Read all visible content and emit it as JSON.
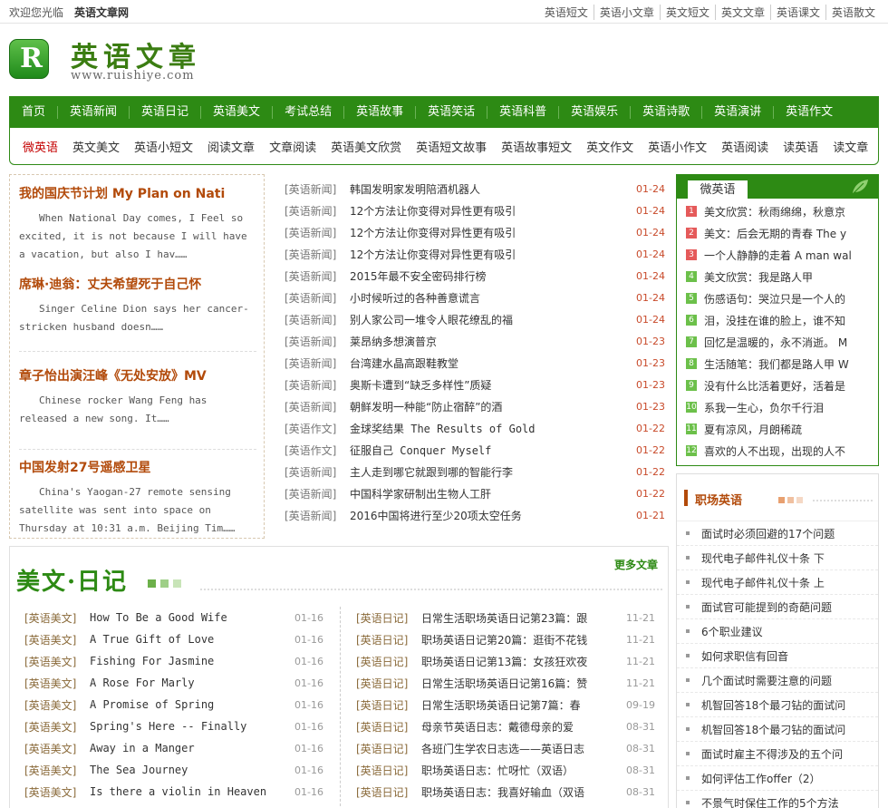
{
  "topbar": {
    "welcome": "欢迎您光临",
    "sitename": "英语文章网",
    "links": [
      "英语短文",
      "英语小文章",
      "英文短文",
      "英文文章",
      "英语课文",
      "英语散文"
    ]
  },
  "logo": {
    "letter": "R",
    "title": "英语文章",
    "url": "www.ruishiye.com"
  },
  "nav": {
    "main": [
      "首页",
      "英语新闻",
      "英语日记",
      "英语美文",
      "考试总结",
      "英语故事",
      "英语笑话",
      "英语科普",
      "英语娱乐",
      "英语诗歌",
      "英语演讲",
      "英语作文"
    ],
    "sub": [
      "微英语",
      "英文美文",
      "英语小短文",
      "阅读文章",
      "文章阅读",
      "英语美文欣赏",
      "英语短文故事",
      "英语故事短文",
      "英文作文",
      "英语小作文",
      "英语阅读",
      "读英语",
      "读文章"
    ]
  },
  "featured": [
    {
      "title": "我的国庆节计划 My Plan on Nati",
      "summary": "When National Day comes, I Feel so excited, it is not because I will have a vacation, but also I hav……"
    },
    {
      "title": "席琳·迪翁：丈夫希望死于自己怀",
      "summary": "Singer Celine Dion says her cancer-stricken husband doesn……"
    },
    {
      "title": "章子怡出演汪峰《无处安放》MV",
      "summary": "Chinese rocker Wang Feng has released a new song. It……"
    },
    {
      "title": "中国发射27号遥感卫星",
      "summary": "China's Yaogan-27 remote sensing satellite was sent into space on Thursday at 10:31 a.m. Beijing Tim……"
    }
  ],
  "news": [
    {
      "cat": "[英语新闻]",
      "title": "韩国发明家发明陪酒机器人",
      "date": "01-24"
    },
    {
      "cat": "[英语新闻]",
      "title": "12个方法让你变得对异性更有吸引",
      "date": "01-24"
    },
    {
      "cat": "[英语新闻]",
      "title": "12个方法让你变得对异性更有吸引",
      "date": "01-24"
    },
    {
      "cat": "[英语新闻]",
      "title": "12个方法让你变得对异性更有吸引",
      "date": "01-24"
    },
    {
      "cat": "[英语新闻]",
      "title": "2015年最不安全密码排行榜",
      "date": "01-24"
    },
    {
      "cat": "[英语新闻]",
      "title": "小时候听过的各种善意谎言",
      "date": "01-24"
    },
    {
      "cat": "[英语新闻]",
      "title": "别人家公司一堆令人眼花缭乱的福",
      "date": "01-24"
    },
    {
      "cat": "[英语新闻]",
      "title": "莱昂纳多想演普京",
      "date": "01-23"
    },
    {
      "cat": "[英语新闻]",
      "title": "台湾建水晶高跟鞋教堂",
      "date": "01-23"
    },
    {
      "cat": "[英语新闻]",
      "title": "奥斯卡遭到“缺乏多样性”质疑",
      "date": "01-23"
    },
    {
      "cat": "[英语新闻]",
      "title": "朝鲜发明一种能“防止宿醉”的酒",
      "date": "01-23"
    },
    {
      "cat": "[英语作文]",
      "title": "金球奖结果 The Results of Gold",
      "date": "01-22"
    },
    {
      "cat": "[英语作文]",
      "title": "征服自己 Conquer Myself",
      "date": "01-22"
    },
    {
      "cat": "[英语新闻]",
      "title": "主人走到哪它就跟到哪的智能行李",
      "date": "01-22"
    },
    {
      "cat": "[英语新闻]",
      "title": "中国科学家研制出生物人工肝",
      "date": "01-22"
    },
    {
      "cat": "[英语新闻]",
      "title": "2016中国将进行至少20项太空任务",
      "date": "01-21"
    }
  ],
  "micro": {
    "tab": "微英语",
    "items": [
      {
        "n": "1",
        "title": "美文欣赏：秋雨绵绵，秋意京"
      },
      {
        "n": "2",
        "title": "美文：后会无期的青春 The y"
      },
      {
        "n": "3",
        "title": "一个人静静的走着 A man wal"
      },
      {
        "n": "4",
        "title": "美文欣赏：我是路人甲"
      },
      {
        "n": "5",
        "title": "伤感语句：哭泣只是一个人的"
      },
      {
        "n": "6",
        "title": "泪，没挂在谁的脸上，谁不知"
      },
      {
        "n": "7",
        "title": "回忆是温暖的，永不消逝。 M"
      },
      {
        "n": "8",
        "title": "生活随笔：我们都是路人甲 W"
      },
      {
        "n": "9",
        "title": "没有什么比活着更好，活着是"
      },
      {
        "n": "10",
        "title": "系我一生心，负尔千行泪"
      },
      {
        "n": "11",
        "title": "夏有凉风，月朗稀疏"
      },
      {
        "n": "12",
        "title": "喜欢的人不出现，出现的人不"
      }
    ]
  },
  "career": {
    "title": "职场英语",
    "items": [
      "面试时必须回避的17个问题",
      "现代电子邮件礼仪十条 下",
      "现代电子邮件礼仪十条 上",
      "面试官可能提到的奇葩问题",
      "6个职业建议",
      "如何求职信有回音",
      "几个面试时需要注意的问题",
      "机智回答18个最刁钻的面试问",
      "机智回答18个最刁钻的面试问",
      "面试时雇主不得涉及的五个问",
      "如何评估工作offer（2）",
      "不景气时保住工作的5个方法"
    ]
  },
  "articles": {
    "title": "美文·日记",
    "more": "更多文章",
    "left": [
      {
        "cat": "[英语美文]",
        "title": "How To Be a Good Wife",
        "date": "01-16"
      },
      {
        "cat": "[英语美文]",
        "title": "A True Gift of Love",
        "date": "01-16"
      },
      {
        "cat": "[英语美文]",
        "title": "Fishing For Jasmine",
        "date": "01-16"
      },
      {
        "cat": "[英语美文]",
        "title": "A Rose For Marly",
        "date": "01-16"
      },
      {
        "cat": "[英语美文]",
        "title": "A Promise of Spring",
        "date": "01-16"
      },
      {
        "cat": "[英语美文]",
        "title": "Spring's Here -- Finally",
        "date": "01-16"
      },
      {
        "cat": "[英语美文]",
        "title": "Away in a Manger",
        "date": "01-16"
      },
      {
        "cat": "[英语美文]",
        "title": "The Sea Journey",
        "date": "01-16"
      },
      {
        "cat": "[英语美文]",
        "title": "Is there a violin in Heaven",
        "date": "01-16"
      }
    ],
    "right": [
      {
        "cat": "[英语日记]",
        "title": "日常生活职场英语日记第23篇：跟",
        "date": "11-21"
      },
      {
        "cat": "[英语日记]",
        "title": "职场英语日记第20篇：逛街不花钱",
        "date": "11-21"
      },
      {
        "cat": "[英语日记]",
        "title": "职场英语日记第13篇：女孩狂欢夜",
        "date": "11-21"
      },
      {
        "cat": "[英语日记]",
        "title": "日常生活职场英语日记第16篇：赞",
        "date": "11-21"
      },
      {
        "cat": "[英语日记]",
        "title": "日常生活职场英语日记第7篇：春",
        "date": "09-19"
      },
      {
        "cat": "[英语日记]",
        "title": "母亲节英语日志：戴德母亲的爱",
        "date": "08-31"
      },
      {
        "cat": "[英语日记]",
        "title": "各班门生学农日志选——英语日志",
        "date": "08-31"
      },
      {
        "cat": "[英语日记]",
        "title": "职场英语日志：忙呀忙（双语）",
        "date": "08-31"
      },
      {
        "cat": "[英语日记]",
        "title": "职场英语日志：我喜好输血（双语",
        "date": "08-31"
      }
    ]
  },
  "colors": {
    "brand_green": "#2d8a14",
    "title_brown": "#b24a0a",
    "date_red": "#c84a2a"
  }
}
